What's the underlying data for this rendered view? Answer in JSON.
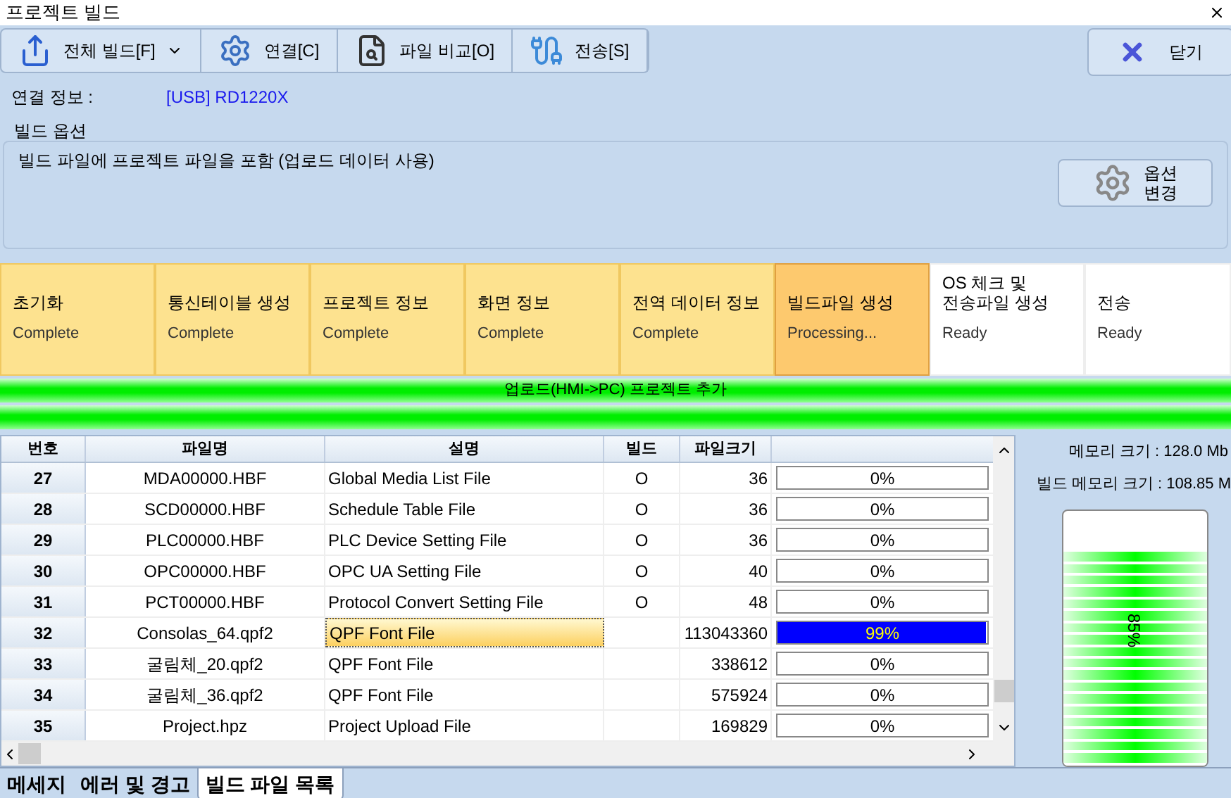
{
  "window": {
    "title": "프로젝트 빌드"
  },
  "toolbar": [
    {
      "label": "전체 빌드[F]",
      "dropdown": true
    },
    {
      "label": "연결[C]",
      "dropdown": false
    },
    {
      "label": "파일 비교[O]",
      "dropdown": false
    },
    {
      "label": "전송[S]",
      "dropdown": false
    }
  ],
  "close_button": {
    "label": "닫기"
  },
  "connection": {
    "label": "연결 정보 :",
    "value": "[USB] RD1220X"
  },
  "build_options": {
    "title": "빌드 옵션",
    "text": "빌드 파일에 프로젝트 파일을 포함 (업로드 데이터 사용)",
    "button": "옵션\n변경"
  },
  "steps": [
    {
      "title": "초기화",
      "status": "Complete",
      "kind": "complete"
    },
    {
      "title": "통신테이블 생성",
      "status": "Complete",
      "kind": "complete"
    },
    {
      "title": "프로젝트 정보",
      "status": "Complete",
      "kind": "complete"
    },
    {
      "title": "화면 정보",
      "status": "Complete",
      "kind": "complete"
    },
    {
      "title": "전역 데이터 정보",
      "status": "Complete",
      "kind": "complete"
    },
    {
      "title": "빌드파일 생성",
      "status": "Processing...",
      "kind": "processing"
    },
    {
      "title": "OS 체크 및\n전송파일 생성",
      "status": "Ready",
      "kind": "ready"
    },
    {
      "title": "전송",
      "status": "Ready",
      "kind": "ready"
    }
  ],
  "progress_bars": [
    {
      "label": "업로드(HMI->PC) 프로젝트 추가",
      "level": 1
    },
    {
      "level": 1
    }
  ],
  "table": {
    "columns": [
      "번호",
      "파일명",
      "설명",
      "빌드",
      "파일크기"
    ],
    "rows": [
      {
        "no": "27",
        "file": "MDA00000.HBF",
        "desc": "Global Media List File",
        "build": "O",
        "size": "36",
        "progress": "0%",
        "level": 0,
        "selected": false
      },
      {
        "no": "28",
        "file": "SCD00000.HBF",
        "desc": "Schedule Table File",
        "build": "O",
        "size": "36",
        "progress": "0%",
        "level": 0,
        "selected": false
      },
      {
        "no": "29",
        "file": "PLC00000.HBF",
        "desc": "PLC Device Setting File",
        "build": "O",
        "size": "36",
        "progress": "0%",
        "level": 0,
        "selected": false
      },
      {
        "no": "30",
        "file": "OPC00000.HBF",
        "desc": "OPC UA Setting File",
        "build": "O",
        "size": "40",
        "progress": "0%",
        "level": 0,
        "selected": false
      },
      {
        "no": "31",
        "file": "PCT00000.HBF",
        "desc": "Protocol Convert Setting File",
        "build": "O",
        "size": "48",
        "progress": "0%",
        "level": 0,
        "selected": false
      },
      {
        "no": "32",
        "file": "Consolas_64.qpf2",
        "desc": "QPF Font File",
        "size": "113043360",
        "progress": "99%",
        "level": 0.99,
        "selected": true
      },
      {
        "no": "33",
        "file": "굴림체_20.qpf2",
        "desc": "QPF Font File",
        "size": "338612",
        "progress": "0%",
        "level": 0,
        "selected": false
      },
      {
        "no": "34",
        "file": "굴림체_36.qpf2",
        "desc": "QPF Font File",
        "size": "575924",
        "progress": "0%",
        "level": 0,
        "selected": false
      },
      {
        "no": "35",
        "file": "Project.hpz",
        "desc": "Project Upload File",
        "size": "169829",
        "progress": "0%",
        "level": 0,
        "selected": false
      }
    ]
  },
  "memory": {
    "size": "메모리 크기 : 128.0 Mb",
    "build_size": "빌드 메모리 크기 : 108.85 M",
    "gauge_label": "85%",
    "level": 0.85
  },
  "bottom_tabs": [
    {
      "label": "메세지",
      "selected": false
    },
    {
      "label": "에러 및 경고",
      "selected": false
    },
    {
      "label": "빌드 파일 목록",
      "selected": true
    }
  ]
}
